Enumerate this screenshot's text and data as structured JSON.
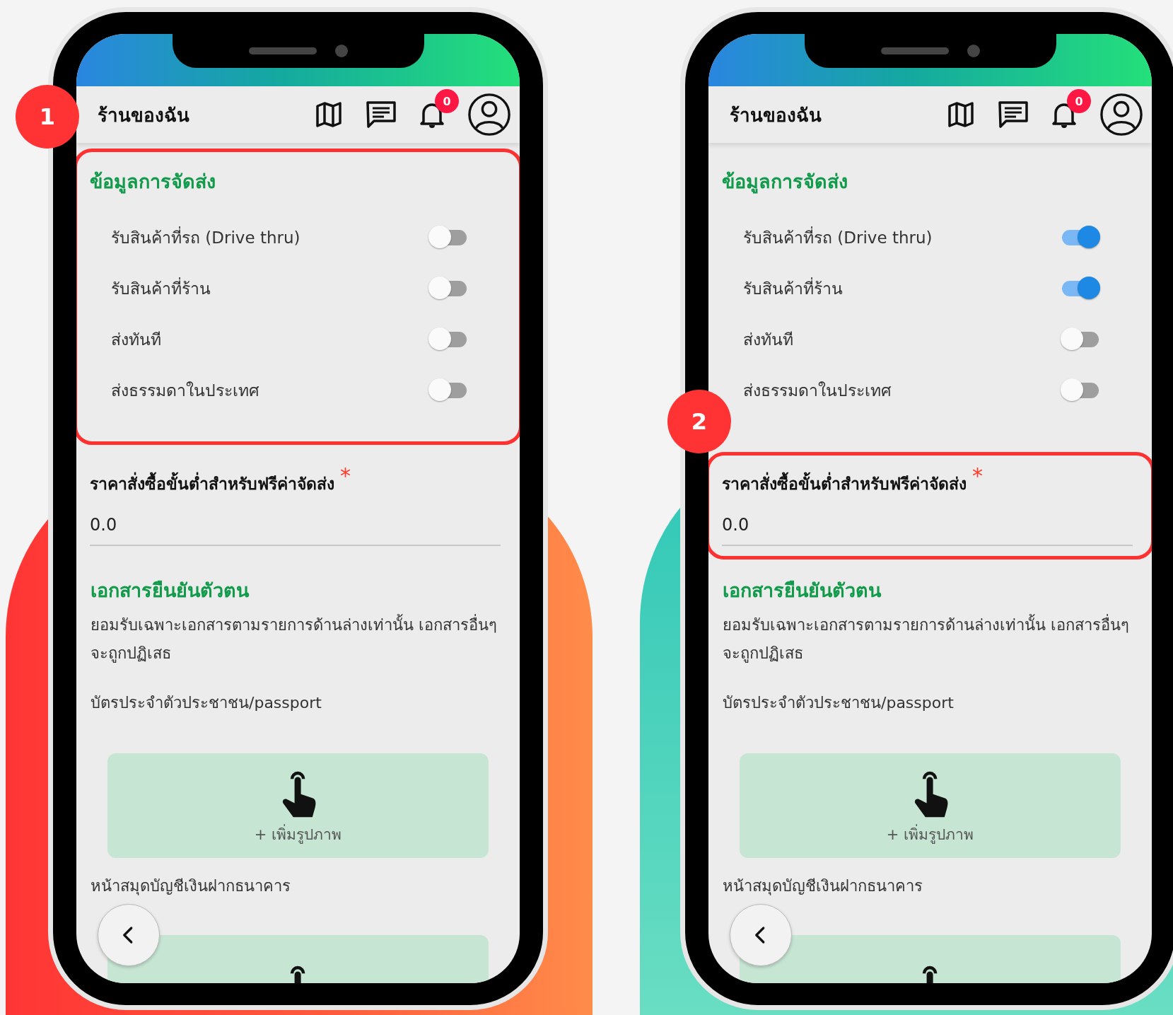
{
  "screens": [
    {
      "step": "1",
      "shop_title": "ร้านของฉัน",
      "notification_count": "0",
      "delivery": {
        "highlighted": true,
        "heading": "ข้อมูลการจัดส่ง",
        "options": [
          {
            "label": "รับสินค้าที่รถ (Drive thru)",
            "on": false
          },
          {
            "label": "รับสินค้าที่ร้าน",
            "on": false
          },
          {
            "label": "ส่งทันที",
            "on": false
          },
          {
            "label": "ส่งธรรมดาในประเทศ",
            "on": false
          }
        ]
      },
      "min_order": {
        "highlighted": false,
        "label": "ราคาสั่งซื้อขั้นต่ำสำหรับฟรีค่าจัดส่ง",
        "required_mark": "*",
        "value": "0.0"
      },
      "documents": {
        "heading": "เอกสารยืนยันตัวตน",
        "note": "ยอมรับเฉพาะเอกสารตามรายการด้านล่างเท่านั้น เอกสารอื่นๆจะถูกปฏิเสธ",
        "uploads": [
          {
            "label": "บัตรประจำตัวประชาชน/passport",
            "button": "+ เพิ่มรูปภาพ"
          },
          {
            "label": "หน้าสมุดบัญชีเงินฝากธนาคาร"
          }
        ]
      }
    },
    {
      "step": "2",
      "shop_title": "ร้านของฉัน",
      "notification_count": "0",
      "delivery": {
        "highlighted": false,
        "heading": "ข้อมูลการจัดส่ง",
        "options": [
          {
            "label": "รับสินค้าที่รถ (Drive thru)",
            "on": true
          },
          {
            "label": "รับสินค้าที่ร้าน",
            "on": true
          },
          {
            "label": "ส่งทันที",
            "on": false
          },
          {
            "label": "ส่งธรรมดาในประเทศ",
            "on": false
          }
        ]
      },
      "min_order": {
        "highlighted": true,
        "label": "ราคาสั่งซื้อขั้นต่ำสำหรับฟรีค่าจัดส่ง",
        "required_mark": "*",
        "value": "0.0"
      },
      "documents": {
        "heading": "เอกสารยืนยันตัวตน",
        "note": "ยอมรับเฉพาะเอกสารตามรายการด้านล่างเท่านั้น เอกสารอื่นๆจะถูกปฏิเสธ",
        "uploads": [
          {
            "label": "บัตรประจำตัวประชาชน/passport",
            "button": "+ เพิ่มรูปภาพ"
          },
          {
            "label": "หน้าสมุดบัญชีเงินฝากธนาคาร"
          }
        ]
      }
    }
  ]
}
